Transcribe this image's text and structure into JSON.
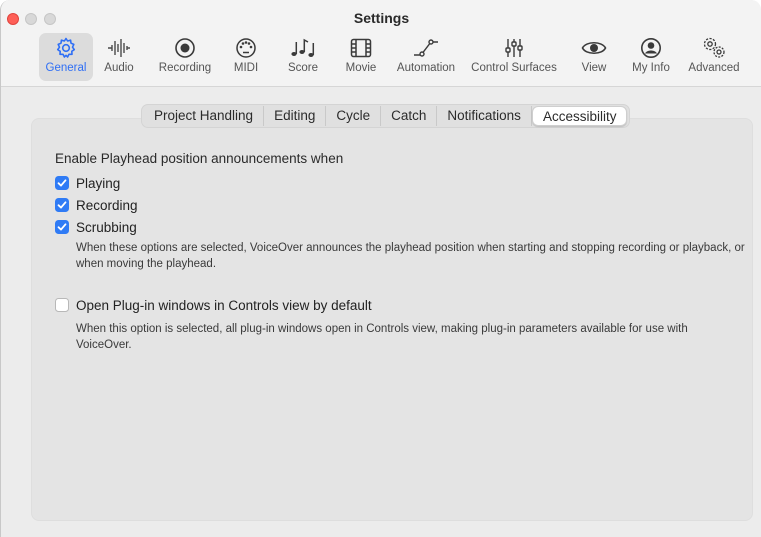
{
  "window": {
    "title": "Settings"
  },
  "toolbar": {
    "items": [
      {
        "label": "General",
        "icon": "gear-icon",
        "active": true
      },
      {
        "label": "Audio",
        "icon": "waveform-icon",
        "active": false
      },
      {
        "label": "Recording",
        "icon": "record-icon",
        "active": false
      },
      {
        "label": "MIDI",
        "icon": "midi-port-icon",
        "active": false
      },
      {
        "label": "Score",
        "icon": "music-notes-icon",
        "active": false
      },
      {
        "label": "Movie",
        "icon": "film-icon",
        "active": false
      },
      {
        "label": "Automation",
        "icon": "automation-curve-icon",
        "active": false
      },
      {
        "label": "Control Surfaces",
        "icon": "faders-icon",
        "active": false
      },
      {
        "label": "View",
        "icon": "eye-icon",
        "active": false
      },
      {
        "label": "My Info",
        "icon": "person-icon",
        "active": false
      },
      {
        "label": "Advanced",
        "icon": "gears-icon",
        "active": false
      }
    ]
  },
  "tabs": {
    "items": [
      "Project Handling",
      "Editing",
      "Cycle",
      "Catch",
      "Notifications",
      "Accessibility"
    ],
    "selected": "Accessibility"
  },
  "accessibility": {
    "heading": "Enable Playhead position announcements when",
    "options": [
      {
        "label": "Playing",
        "checked": true
      },
      {
        "label": "Recording",
        "checked": true
      },
      {
        "label": "Scrubbing",
        "checked": true
      }
    ],
    "voiceover_description": "When these options are selected, VoiceOver announces the playhead position when starting and stopping recording or playback, or when moving the playhead.",
    "plugin_option": {
      "label": "Open Plug-in windows in Controls view by default",
      "checked": false
    },
    "plugin_description": "When this option is selected, all plug-in windows open in Controls view, making plug-in parameters available for use with VoiceOver."
  },
  "colors": {
    "accent": "#2f7bf5",
    "close": "#fe5f57"
  }
}
